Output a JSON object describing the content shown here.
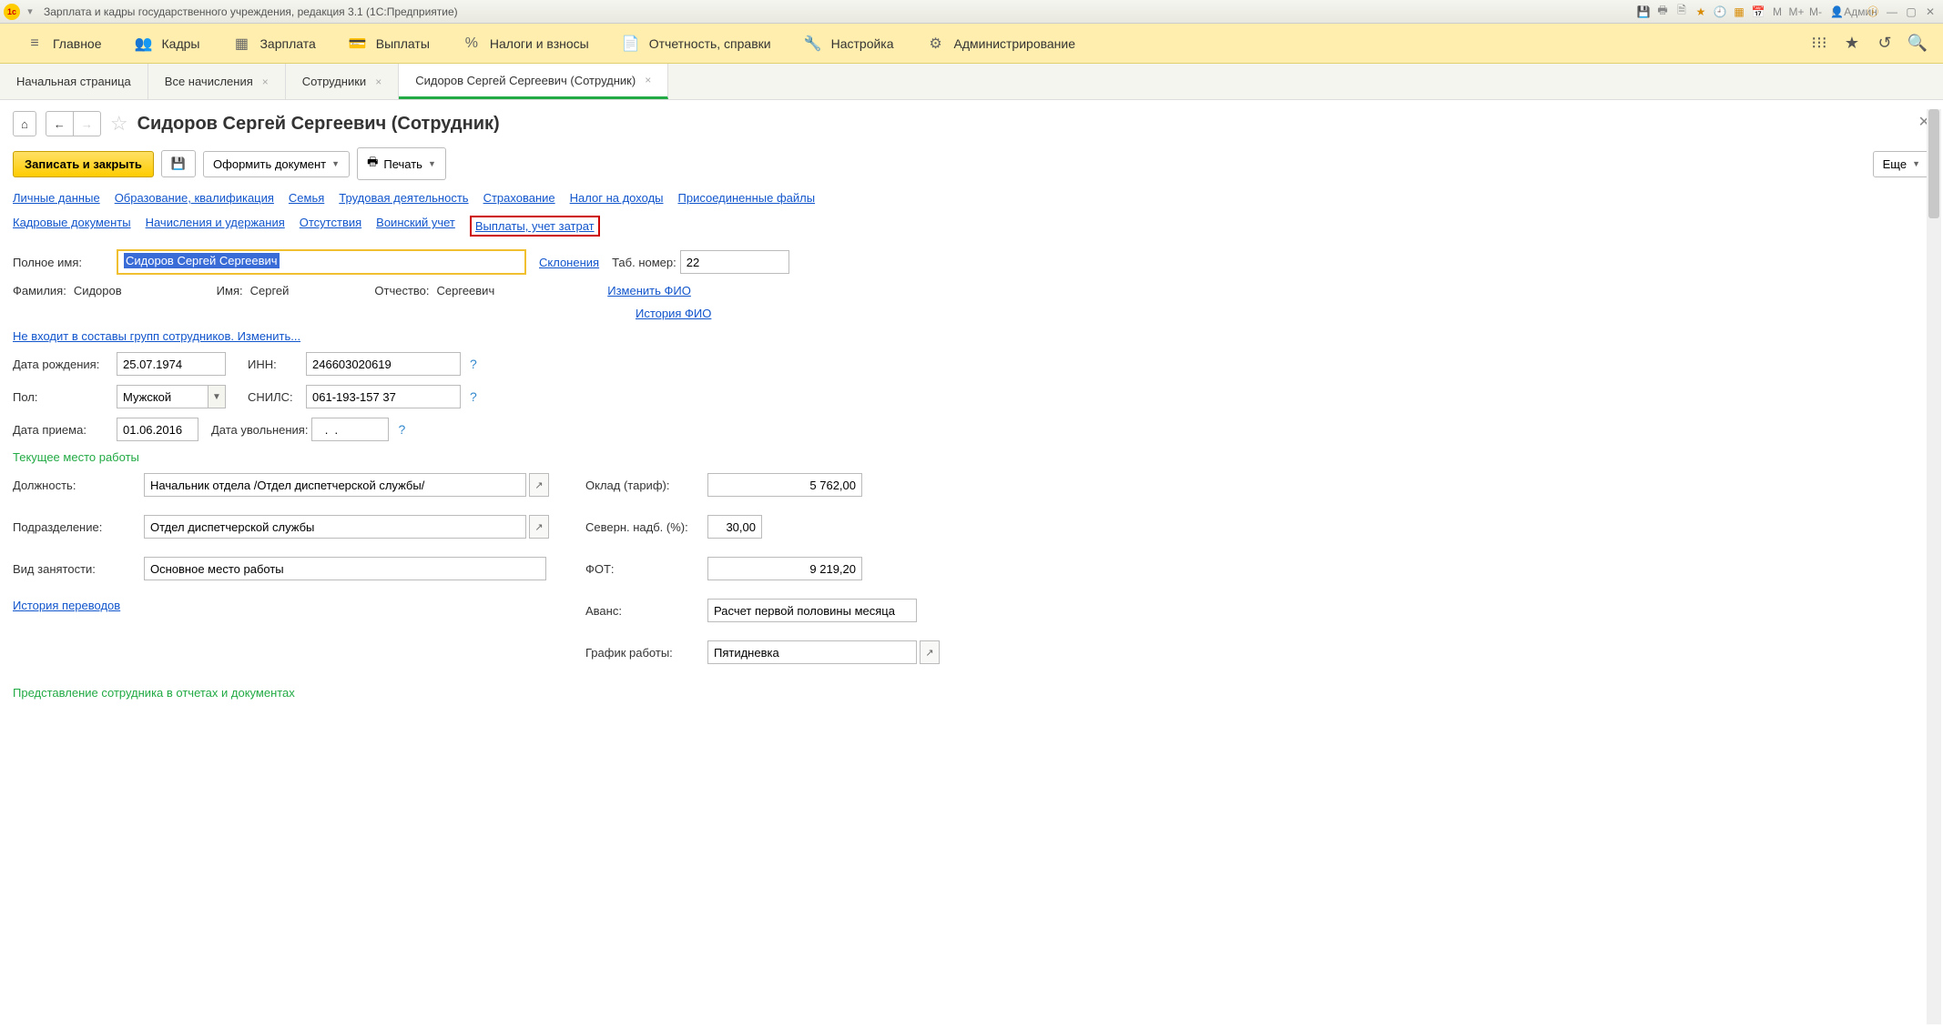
{
  "titlebar": {
    "title": "Зарплата и кадры государственного учреждения, редакция 3.1  (1С:Предприятие)",
    "user": "Админ"
  },
  "mainmenu": {
    "items": [
      "Главное",
      "Кадры",
      "Зарплата",
      "Выплаты",
      "Налоги и взносы",
      "Отчетность, справки",
      "Настройка",
      "Администрирование"
    ]
  },
  "tabs": {
    "items": [
      {
        "label": "Начальная страница",
        "closable": false
      },
      {
        "label": "Все начисления",
        "closable": true
      },
      {
        "label": "Сотрудники",
        "closable": true
      },
      {
        "label": "Сидоров Сергей Сергеевич (Сотрудник)",
        "closable": true,
        "active": true
      }
    ]
  },
  "page": {
    "title": "Сидоров Сергей Сергеевич (Сотрудник)"
  },
  "toolbar": {
    "save_close": "Записать и закрыть",
    "doc": "Оформить документ",
    "print": "Печать",
    "more": "Еще"
  },
  "navlinks": {
    "row1": [
      "Личные данные",
      "Образование, квалификация",
      "Семья",
      "Трудовая деятельность",
      "Страхование",
      "Налог на доходы",
      "Присоединенные файлы"
    ],
    "row2": [
      "Кадровые документы",
      "Начисления и удержания",
      "Отсутствия",
      "Воинский учет"
    ],
    "row2_hl": "Выплаты, учет затрат"
  },
  "fields": {
    "full_name_lbl": "Полное имя:",
    "full_name": "Сидоров Сергей Сергеевич",
    "declension": "Склонения",
    "tab_no_lbl": "Таб. номер:",
    "tab_no": "22",
    "surname_lbl": "Фамилия:",
    "surname": "Сидоров",
    "name_lbl": "Имя:",
    "name": "Сергей",
    "patr_lbl": "Отчество:",
    "patr": "Сергеевич",
    "change_fio": "Изменить ФИО",
    "history_fio": "История ФИО",
    "groups_link": "Не входит в составы групп сотрудников. Изменить...",
    "dob_lbl": "Дата рождения:",
    "dob": "25.07.1974",
    "inn_lbl": "ИНН:",
    "inn": "246603020619",
    "sex_lbl": "Пол:",
    "sex": "Мужской",
    "snils_lbl": "СНИЛС:",
    "snils": "061-193-157 37",
    "hire_lbl": "Дата приема:",
    "hire": "01.06.2016",
    "fire_lbl": "Дата увольнения:",
    "fire": "  .  .",
    "section_work": "Текущее место работы",
    "pos_lbl": "Должность:",
    "pos": "Начальник отдела /Отдел диспетчерской службы/",
    "dept_lbl": "Подразделение:",
    "dept": "Отдел диспетчерской службы",
    "emp_type_lbl": "Вид занятости:",
    "emp_type": "Основное место работы",
    "transfers": "История переводов",
    "salary_lbl": "Оклад (тариф):",
    "salary": "5 762,00",
    "north_lbl": "Северн. надб. (%):",
    "north": "30,00",
    "fot_lbl": "ФОТ:",
    "fot": "9 219,20",
    "advance_lbl": "Аванс:",
    "advance": "Расчет первой половины месяца",
    "sched_lbl": "График работы:",
    "sched": "Пятидневка",
    "section_repr": "Представление сотрудника в отчетах и документах"
  }
}
